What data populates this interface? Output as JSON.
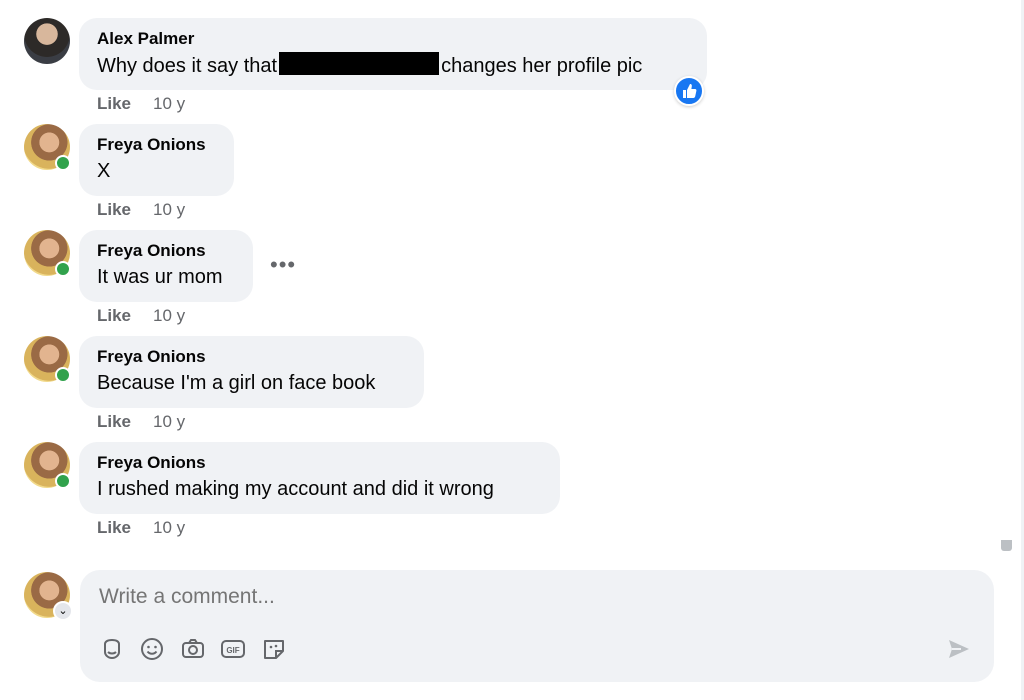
{
  "comments": [
    {
      "author": "Alex Palmer",
      "text_before": "Why does it say that",
      "text_after": "changes her profile pic",
      "like_label": "Like",
      "time": "10 y"
    },
    {
      "author": "Freya Onions",
      "text": "X",
      "like_label": "Like",
      "time": "10 y"
    },
    {
      "author": "Freya Onions",
      "text": "It was ur mom",
      "like_label": "Like",
      "time": "10 y",
      "more": "•••"
    },
    {
      "author": "Freya Onions",
      "text": "Because I'm a girl on face book",
      "like_label": "Like",
      "time": "10 y"
    },
    {
      "author": "Freya Onions",
      "text": "I rushed making my account and did it wrong",
      "like_label": "Like",
      "time": "10 y"
    }
  ],
  "composer": {
    "placeholder": "Write a comment...",
    "tools": [
      "sticker-icon",
      "emoji-icon",
      "camera-icon",
      "gif-icon",
      "avatar-sticker-icon"
    ],
    "send_icon": "send-icon",
    "gif_label": "GIF"
  },
  "colors": {
    "bubble": "#f0f2f5",
    "accent": "#1877f2",
    "online": "#31a24c",
    "meta": "#65676b"
  }
}
